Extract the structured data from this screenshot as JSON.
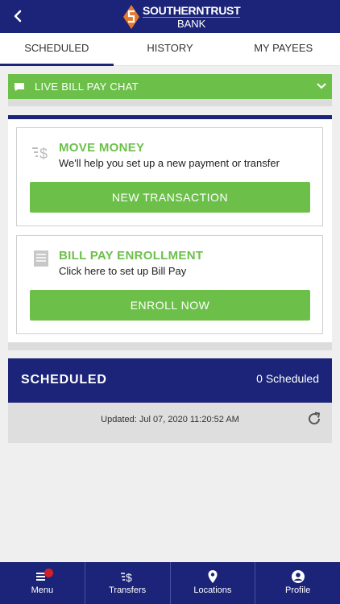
{
  "header": {
    "brand_line1": "SOUTHERNTRUST",
    "brand_line2": "BANK",
    "back_icon": "chevron-left-icon"
  },
  "tabs": [
    {
      "label": "SCHEDULED",
      "active": true
    },
    {
      "label": "HISTORY",
      "active": false
    },
    {
      "label": "MY PAYEES",
      "active": false
    }
  ],
  "chat": {
    "label": "LIVE BILL PAY CHAT",
    "icon": "chat-icon"
  },
  "move_money": {
    "title": "MOVE MONEY",
    "subtitle": "We'll help you set up a new payment or transfer",
    "button": "NEW TRANSACTION"
  },
  "enrollment": {
    "title": "BILL PAY ENROLLMENT",
    "subtitle": "Click here to set up Bill Pay",
    "button": "ENROLL NOW"
  },
  "scheduled": {
    "title": "SCHEDULED",
    "count": "0 Scheduled",
    "updated_label": "Updated:",
    "updated_value": "Jul 07, 2020 11:20:52 AM"
  },
  "nav": [
    {
      "label": "Menu",
      "icon": "menu-icon"
    },
    {
      "label": "Transfers",
      "icon": "transfer-icon"
    },
    {
      "label": "Locations",
      "icon": "location-pin-icon"
    },
    {
      "label": "Profile",
      "icon": "profile-icon"
    }
  ],
  "colors": {
    "primary": "#1b2478",
    "accent": "#6cc04a",
    "badge": "#d0202a"
  }
}
